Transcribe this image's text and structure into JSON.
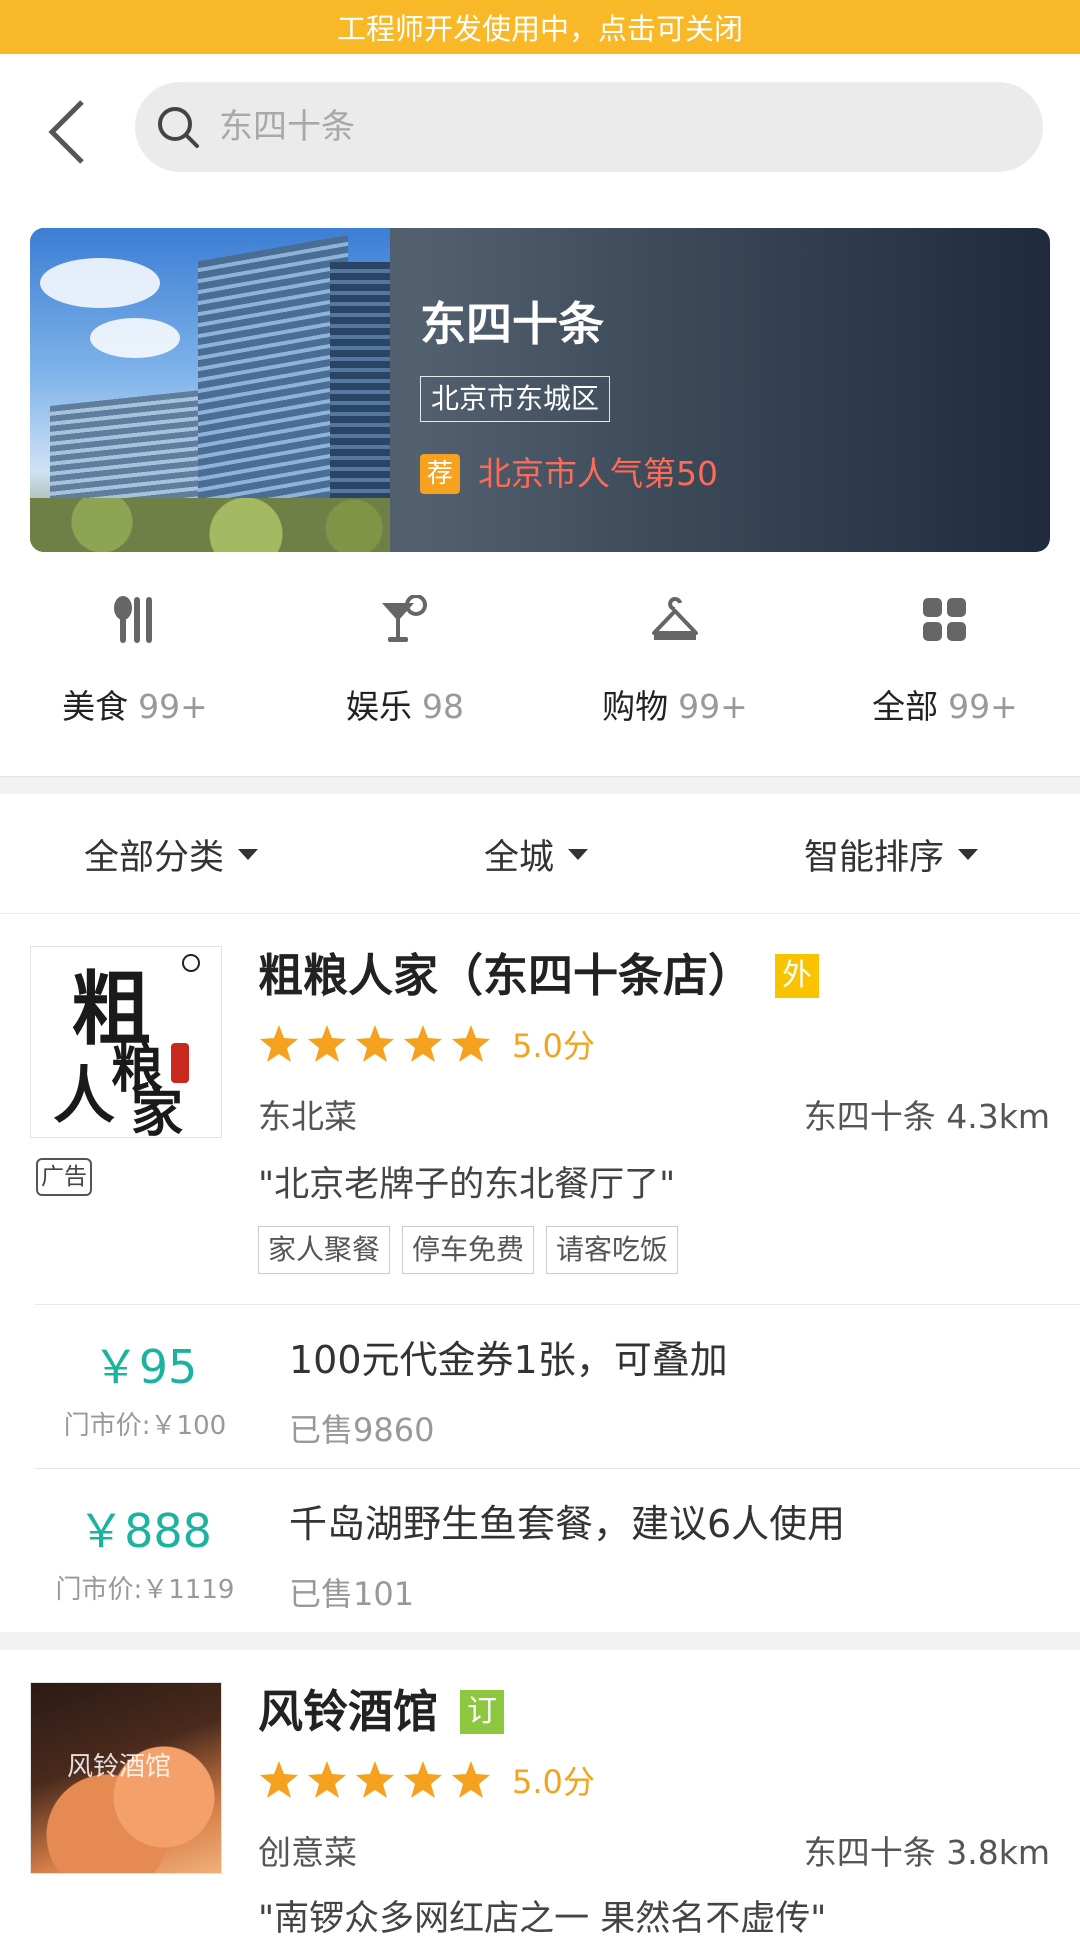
{
  "dev_banner": "工程师开发使用中，点击可关闭",
  "search": {
    "placeholder": "东四十条"
  },
  "hero": {
    "title": "东四十条",
    "district": "北京市东城区",
    "badge": "荐",
    "rank": "北京市人气第50"
  },
  "categories": [
    {
      "name": "美食",
      "count": "99+",
      "icon": "food-icon"
    },
    {
      "name": "娱乐",
      "count": "98",
      "icon": "cocktail-icon"
    },
    {
      "name": "购物",
      "count": "99+",
      "icon": "hanger-icon"
    },
    {
      "name": "全部",
      "count": "99+",
      "icon": "grid-icon"
    }
  ],
  "filters": [
    "全部分类",
    "全城",
    "智能排序"
  ],
  "shops": [
    {
      "name": "粗粮人家（东四十条店）",
      "badge": "外",
      "badge_color": "#f9c300",
      "score": "5.0分",
      "rating": 5,
      "cuisine": "东北菜",
      "location": "东四十条 4.3km",
      "ad": "广告",
      "quote": "\"北京老牌子的东北餐厅了\"",
      "tags": [
        "家人聚餐",
        "停车免费",
        "请客吃饭"
      ],
      "logo_text": "粗 人 粮 家",
      "deals": [
        {
          "price": "￥95",
          "original": "门市价:￥100",
          "title": "100元代金券1张，可叠加",
          "sold": "已售9860"
        },
        {
          "price": "￥888",
          "original": "门市价:￥1119",
          "title": "千岛湖野生鱼套餐，建议6人使用",
          "sold": "已售101"
        }
      ]
    },
    {
      "name": "风铃酒馆",
      "badge": "订",
      "badge_color": "#8dc63f",
      "score": "5.0分",
      "rating": 5,
      "cuisine": "创意菜",
      "location": "东四十条 3.8km",
      "quote": "\"南锣众多网红店之一 果然名不虚传\""
    }
  ]
}
